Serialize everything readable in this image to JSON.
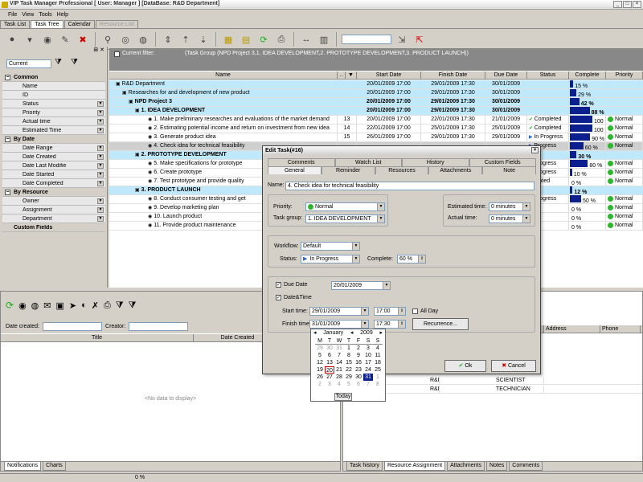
{
  "app": {
    "title": "VIP Task Manager Professional [ User: Manager ] [DataBase: R&D Department]"
  },
  "menu": [
    "File",
    "View",
    "Tools",
    "Help"
  ],
  "doc_tabs": [
    {
      "label": "Task List",
      "active": false
    },
    {
      "label": "Task Tree",
      "active": true
    },
    {
      "label": "Calendar",
      "active": false
    },
    {
      "label": "Resource List",
      "active": false,
      "disabled": true
    }
  ],
  "filter_panel": {
    "combo": "Current",
    "categories": [
      {
        "label": "Common",
        "items": [
          "Name",
          "ID",
          "Status",
          "Priority",
          "Actual time",
          "Estimated Time"
        ]
      },
      {
        "label": "By Date",
        "items": [
          "Date Range",
          "Date Created",
          "Date Last Modifie",
          "Date Started",
          "Date Completed"
        ]
      },
      {
        "label": "By Resource",
        "items": [
          "Owner",
          "Assignment",
          "Department"
        ]
      },
      {
        "label": "Custom Fields",
        "items": []
      }
    ]
  },
  "filter_bar": {
    "label": "Current filter:",
    "text": "(Task Group  (NPD Project 3,1. IDEA DEVELOPMENT,2. PROTOTYPE DEVELOPMENT,3. PRODUCT LAUNCH))"
  },
  "grid": {
    "columns": [
      "Name",
      "..",
      "▼",
      "Start Date",
      "Finish Date",
      "Due Date",
      "Status",
      "Complete",
      "Priority"
    ],
    "rows": [
      {
        "name": "R&D Department",
        "id": "",
        "start": "20/01/2009 17:00",
        "finish": "29/01/2009 17:30",
        "due": "30/01/2009",
        "status": "",
        "complete": "15 %",
        "pct": 15,
        "priority": "",
        "style": "cy"
      },
      {
        "name": "Researches for and development of new product",
        "id": "",
        "start": "20/01/2009 17:00",
        "finish": "29/01/2009 17:30",
        "due": "30/01/2009",
        "status": "",
        "complete": "29 %",
        "pct": 29,
        "priority": "",
        "style": "cy"
      },
      {
        "name": "NPD Project 3",
        "id": "",
        "start": "20/01/2009 17:00",
        "finish": "29/01/2009 17:30",
        "due": "30/01/2009",
        "status": "",
        "complete": "42 %",
        "pct": 42,
        "priority": "",
        "style": "cy grp"
      },
      {
        "name": "1. IDEA DEVELOPMENT",
        "id": "",
        "start": "20/01/2009 17:00",
        "finish": "29/01/2009 17:30",
        "due": "30/01/2009",
        "status": "",
        "complete": "88 %",
        "pct": 88,
        "priority": "",
        "style": "cy grp"
      },
      {
        "name": "1. Make preliminary researches and evaluations of the market demand",
        "id": "13",
        "start": "20/01/2009 17:00",
        "finish": "22/01/2009 17:30",
        "due": "21/01/2009",
        "status": "Completed",
        "complete": "100 %",
        "pct": 100,
        "priority": "Normal",
        "style": ""
      },
      {
        "name": "2. Estimating potential income and return on investment from new idea",
        "id": "14",
        "start": "22/01/2009 17:00",
        "finish": "25/01/2009 17:30",
        "due": "25/01/2009",
        "status": "Completed",
        "complete": "100 %",
        "pct": 100,
        "priority": "Normal",
        "style": ""
      },
      {
        "name": "3. Generate product idea",
        "id": "15",
        "start": "26/01/2009 17:00",
        "finish": "29/01/2009 17:30",
        "due": "29/01/2009",
        "status": "In Progress",
        "complete": "90 %",
        "pct": 90,
        "priority": "Normal",
        "style": ""
      },
      {
        "name": "4. Check idea for technical feasibility",
        "id": "",
        "start": "",
        "finish": "",
        "due": "",
        "status": "Progress",
        "complete": "60 %",
        "pct": 60,
        "priority": "Normal",
        "style": "sel"
      },
      {
        "name": "2. PROTOTYPE DEVELOPMENT",
        "id": "",
        "start": "",
        "finish": "",
        "due": "",
        "status": "",
        "complete": "30 %",
        "pct": 30,
        "priority": "",
        "style": "cy grp"
      },
      {
        "name": "5. Make specifications for prototype",
        "id": "",
        "start": "",
        "finish": "",
        "due": "",
        "status": "Progress",
        "complete": "80 %",
        "pct": 80,
        "priority": "Normal",
        "style": ""
      },
      {
        "name": "6. Create prototype",
        "id": "",
        "start": "",
        "finish": "",
        "due": "",
        "status": "Progress",
        "complete": "10 %",
        "pct": 10,
        "priority": "Normal",
        "style": ""
      },
      {
        "name": "7. Test prototype and provide quality",
        "id": "",
        "start": "",
        "finish": "",
        "due": "",
        "status": "reated",
        "complete": "0 %",
        "pct": 0,
        "priority": "Normal",
        "style": ""
      },
      {
        "name": "3. PRODUCT LAUNCH",
        "id": "",
        "start": "",
        "finish": "",
        "due": "",
        "status": "",
        "complete": "12 %",
        "pct": 12,
        "priority": "",
        "style": "cy grp"
      },
      {
        "name": "8. Conduct consumer testing and get",
        "id": "",
        "start": "",
        "finish": "",
        "due": "",
        "status": "Progress",
        "complete": "50 %",
        "pct": 50,
        "priority": "Normal",
        "style": ""
      },
      {
        "name": "9. Develop marketing plan",
        "id": "",
        "start": "",
        "finish": "",
        "due": "",
        "status": "aft",
        "complete": "0 %",
        "pct": 0,
        "priority": "Normal",
        "style": ""
      },
      {
        "name": "10. Launch product",
        "id": "",
        "start": "",
        "finish": "",
        "due": "",
        "status": "aft",
        "complete": "0 %",
        "pct": 0,
        "priority": "Normal",
        "style": ""
      },
      {
        "name": "11. Provide product maintenance",
        "id": "",
        "start": "",
        "finish": "",
        "due": "",
        "status": "aft",
        "complete": "0 %",
        "pct": 0,
        "priority": "Normal",
        "style": ""
      }
    ]
  },
  "notifications": {
    "date_created_label": "Date created:",
    "creator_label": "Creator:",
    "columns": [
      "Title",
      "Date Created"
    ],
    "empty": "<No data to display>"
  },
  "left_bottom_tabs": [
    "Notifications",
    "Charts"
  ],
  "resource_panel": {
    "columns": [
      "",
      "",
      "Address",
      "Phone"
    ],
    "rows": [
      {
        "dept": "R&D",
        "role": "SCIENTIST"
      },
      {
        "dept": "R&D",
        "role": "TECHNICIAN"
      }
    ]
  },
  "right_bottom_tabs": [
    "Task history",
    "Resource Assignment",
    "Attachments",
    "Notes",
    "Comments"
  ],
  "status_bar": {
    "progress": "0 %"
  },
  "dialog": {
    "title": "Edit Task(#16)",
    "tabs_row1": [
      "Comments",
      "Watch List",
      "History",
      "Custom Fields"
    ],
    "tabs_row2": [
      "General",
      "Reminder",
      "Resources",
      "Attachments",
      "Note"
    ],
    "name_label": "Name:",
    "name_value": "4. Check idea for technical feasibility",
    "priority_label": "Priority:",
    "priority_value": "Normal",
    "task_group_label": "Task group:",
    "task_group_value": "1. IDEA DEVELOPMENT",
    "est_time_label": "Estimated time:",
    "est_time_value": "0 minutes",
    "act_time_label": "Actual time:",
    "act_time_value": "0 minutes",
    "workflow_label": "Workflow:",
    "workflow_value": "Default",
    "status_label": "Status:",
    "status_value": "In Progress",
    "complete_label": "Complete:",
    "complete_value": "60 %",
    "due_date_label": "Due Date",
    "due_date_value": "20/01/2009",
    "datetime_label": "Date&Time",
    "start_time_label": "Start time:",
    "start_date_value": "29/01/2009",
    "start_hour_value": "17:00",
    "all_day_label": "All Day",
    "finish_time_label": "Finish time:",
    "finish_date_value": "31/01/2009",
    "finish_hour_value": "17:30",
    "recurrence_label": "Recurrence...",
    "ok_label": "Ok",
    "cancel_label": "Cancel"
  },
  "calendar": {
    "month": "January",
    "year": "2009",
    "dow": [
      "M",
      "T",
      "W",
      "T",
      "F",
      "S",
      "S"
    ],
    "days": [
      [
        "29",
        "30",
        "31",
        "1",
        "2",
        "3",
        "4"
      ],
      [
        "5",
        "6",
        "7",
        "8",
        "9",
        "10",
        "11"
      ],
      [
        "12",
        "13",
        "14",
        "15",
        "16",
        "17",
        "18"
      ],
      [
        "19",
        "20",
        "21",
        "22",
        "23",
        "24",
        "25"
      ],
      [
        "26",
        "27",
        "28",
        "29",
        "30",
        "31",
        "1"
      ],
      [
        "2",
        "3",
        "4",
        "5",
        "6",
        "7",
        "8"
      ]
    ],
    "today_label": "Today",
    "selected_day": "31",
    "today_day": "20"
  }
}
